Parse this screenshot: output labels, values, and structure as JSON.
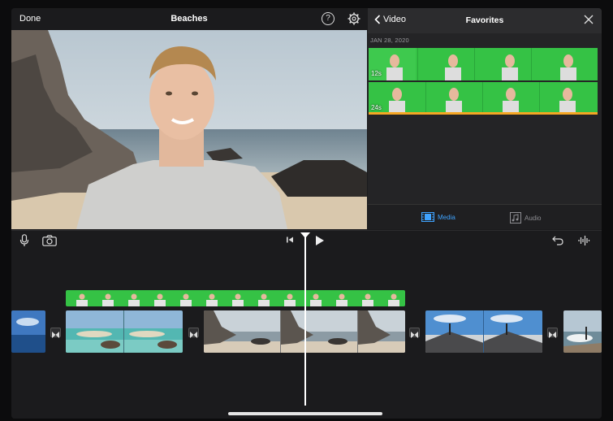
{
  "header": {
    "done_label": "Done",
    "project_title": "Beaches",
    "help_label": "?"
  },
  "browser": {
    "back_label": "Video",
    "title": "Favorites",
    "date": "JAN 28, 2020",
    "clips": [
      {
        "duration": "12s"
      },
      {
        "duration": "24s"
      }
    ],
    "tabs": {
      "media": "Media",
      "audio": "Audio"
    }
  },
  "colors": {
    "accent": "#3fa3ff",
    "green_screen": "#35c245",
    "selected_bar": "#f5a623"
  }
}
